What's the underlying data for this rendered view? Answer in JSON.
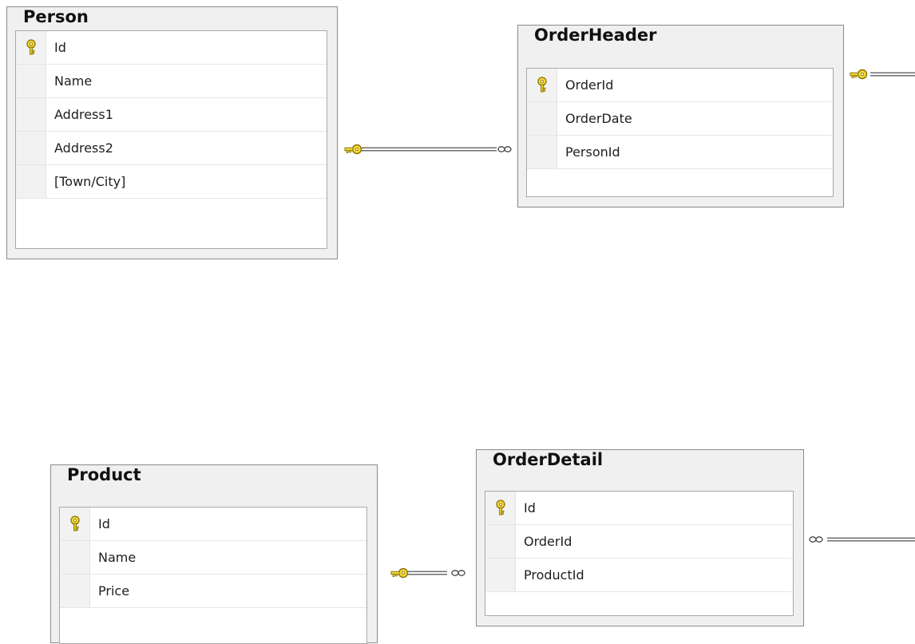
{
  "diagram": {
    "tables": [
      {
        "name": "Person",
        "columns": [
          {
            "name": "Id",
            "primary_key": true
          },
          {
            "name": "Name",
            "primary_key": false
          },
          {
            "name": "Address1",
            "primary_key": false
          },
          {
            "name": "Address2",
            "primary_key": false
          },
          {
            "name": "[Town/City]",
            "primary_key": false
          }
        ]
      },
      {
        "name": "OrderHeader",
        "columns": [
          {
            "name": "OrderId",
            "primary_key": true
          },
          {
            "name": "OrderDate",
            "primary_key": false
          },
          {
            "name": "PersonId",
            "primary_key": false
          }
        ]
      },
      {
        "name": "Product",
        "columns": [
          {
            "name": "Id",
            "primary_key": true
          },
          {
            "name": "Name",
            "primary_key": false
          },
          {
            "name": "Price",
            "primary_key": false
          }
        ]
      },
      {
        "name": "OrderDetail",
        "columns": [
          {
            "name": "Id",
            "primary_key": true
          },
          {
            "name": "OrderId",
            "primary_key": false
          },
          {
            "name": "ProductId",
            "primary_key": false
          }
        ]
      }
    ],
    "relationships": [
      {
        "from": "Person",
        "to": "OrderHeader",
        "one_end": "key-icon",
        "many_end": "infinity-icon"
      },
      {
        "from": "Product",
        "to": "OrderDetail",
        "one_end": "key-icon",
        "many_end": "infinity-icon"
      },
      {
        "from": "OrderHeader",
        "to": "offscreen",
        "one_end": "key-icon",
        "many_end": ""
      },
      {
        "from": "OrderDetail",
        "to": "offscreen",
        "one_end": "",
        "many_end": "infinity-icon"
      }
    ],
    "colors": {
      "key_fill": "#f3d83a",
      "key_stroke": "#8a7400",
      "connector": "#6e6e6e",
      "table_background": "#f0f0f0",
      "table_border": "#8a8a8a"
    }
  }
}
